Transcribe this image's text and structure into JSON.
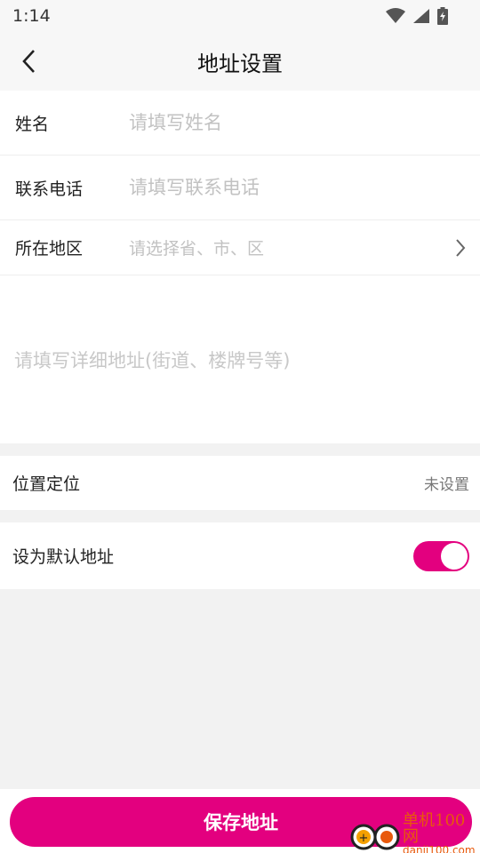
{
  "status_bar": {
    "time": "1:14"
  },
  "header": {
    "title": "地址设置"
  },
  "form": {
    "name": {
      "label": "姓名",
      "placeholder": "请填写姓名"
    },
    "phone": {
      "label": "联系电话",
      "placeholder": "请填写联系电话"
    },
    "region": {
      "label": "所在地区",
      "placeholder": "请选择省、市、区"
    },
    "detail": {
      "placeholder": "请填写详细地址(街道、楼牌号等)"
    }
  },
  "location": {
    "label": "位置定位",
    "value": "未设置"
  },
  "default_address": {
    "label": "设为默认地址",
    "enabled": true
  },
  "actions": {
    "save_label": "保存地址"
  },
  "watermark": {
    "name": "单机100网",
    "url": "danji100.com"
  },
  "colors": {
    "accent": "#e3007f",
    "background": "#f2f2f2",
    "watermark": "#e8590c"
  }
}
